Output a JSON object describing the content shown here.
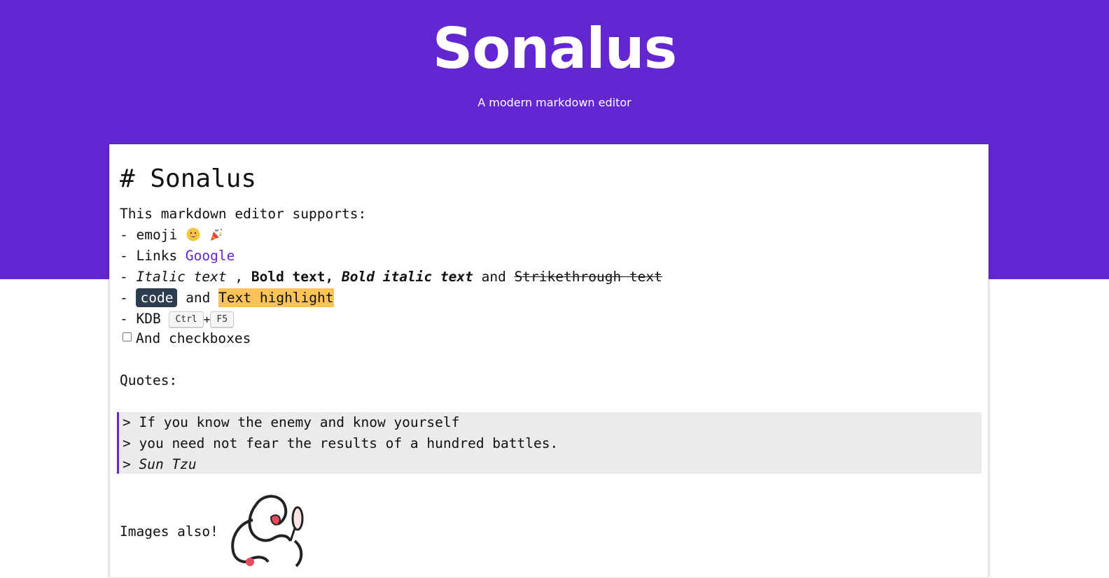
{
  "header": {
    "title": "Sonalus",
    "subtitle": "A modern markdown editor"
  },
  "editor": {
    "heading": "# Sonalus",
    "intro": "This markdown editor supports:",
    "emoji_line": {
      "prefix": "- emoji",
      "icons": [
        "grinning-face-icon",
        "party-popper-icon"
      ]
    },
    "links_line": {
      "prefix": "- Links ",
      "link_text": "Google"
    },
    "formatting_line": {
      "prefix": "- ",
      "italic": "Italic text",
      "sep1": " , ",
      "bold": "Bold text,",
      "sep2": " ",
      "bold_italic": "Bold italic text",
      "and": " and ",
      "strike": "Strikethrough text"
    },
    "code_line": {
      "prefix": "- ",
      "code": "code",
      "and": " and ",
      "highlight": "Text highlight"
    },
    "kbd_line": {
      "prefix": "- KDB ",
      "key1": "Ctrl",
      "plus": "+",
      "key2": "F5"
    },
    "checkbox_label": "And checkboxes",
    "quotes_label": "Quotes:",
    "quote": {
      "line1": "> If you know the enemy and know yourself",
      "line2": "> you need not fear the results of a hundred battles.",
      "line3_prefix": "> ",
      "author": "Sun Tzu"
    },
    "images_label": "Images also!"
  },
  "colors": {
    "brand": "#6327d2",
    "code_bg": "#2e3d4e",
    "highlight": "#fcc359",
    "quote_bg": "#ebebeb"
  }
}
